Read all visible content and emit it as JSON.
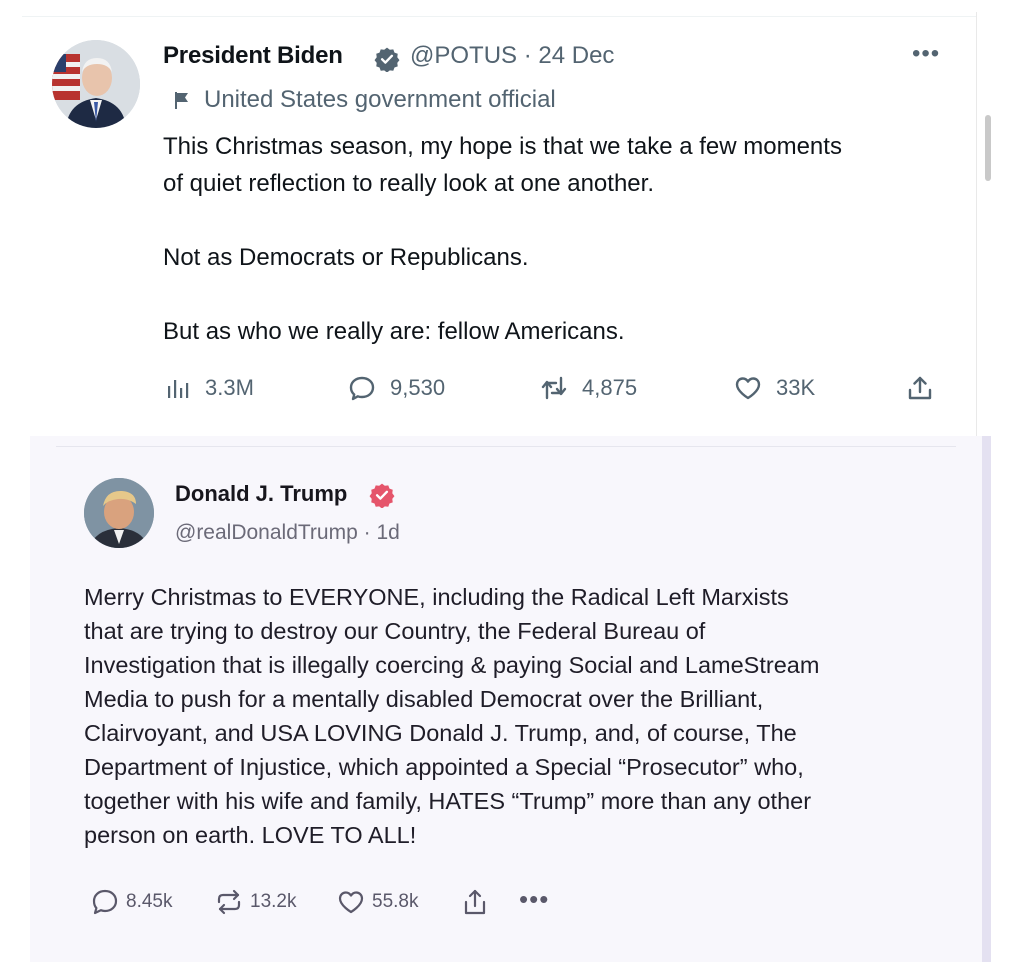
{
  "tweet1": {
    "author_name": "President Biden",
    "handle_date": "@POTUS · 24 Dec",
    "gov_label": "United States government official",
    "text": "This Christmas season, my hope is that we take a few moments\nof quiet reflection to really look at one another.\n\nNot as Democrats or Republicans.\n\nBut as who we really are: fellow Americans.",
    "views": "3.3M",
    "replies": "9,530",
    "retweets": "4,875",
    "likes": "33K",
    "icons": [
      "verified-badge-icon",
      "flag-icon",
      "more-icon",
      "views-icon",
      "reply-icon",
      "retweet-icon",
      "like-icon",
      "share-icon"
    ],
    "colors": {
      "badge": "#536471",
      "text": "#0f1419",
      "muted": "#536471"
    }
  },
  "tweet2": {
    "author_name": "Donald J. Trump",
    "handle_date": "@realDonaldTrump · 1d",
    "text": "Merry Christmas to EVERYONE, including the Radical Left Marxists\nthat are trying to destroy our Country, the Federal Bureau of\nInvestigation that is illegally coercing & paying Social and LameStream\nMedia to push for a mentally disabled Democrat over the Brilliant,\nClairvoyant, and USA LOVING Donald J. Trump,  and, of course, The\nDepartment of Injustice, which appointed a Special “Prosecutor” who,\ntogether with his wife and family, HATES “Trump” more than any other\nperson on earth. LOVE TO ALL!",
    "replies": "8.45k",
    "retruths": "13.2k",
    "likes": "55.8k",
    "icons": [
      "verified-badge-icon",
      "reply-icon",
      "retruth-icon",
      "like-icon",
      "share-icon",
      "more-icon"
    ],
    "colors": {
      "badge": "#e5556b",
      "background": "#f8f7fc",
      "text": "#1f1d28"
    }
  }
}
